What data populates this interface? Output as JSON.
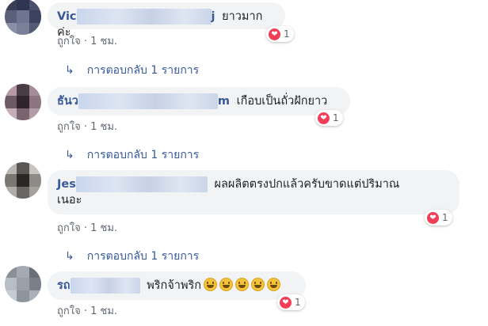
{
  "comments": [
    {
      "name_visible": "Vic",
      "name_suffix": "j",
      "text": "ยาวมากค่ะ",
      "reaction_count": "1",
      "like_label": "ถูกใจ",
      "time": "1 ชม.",
      "replies_label": "การตอบกลับ 1 รายการ"
    },
    {
      "name_visible": "ธันว",
      "name_suffix": "m",
      "text": "เกือบเป็นถั่วฝักยาว",
      "reaction_count": "1",
      "like_label": "ถูกใจ",
      "time": "1 ชม.",
      "replies_label": "การตอบกลับ 1 รายการ"
    },
    {
      "name_visible": "Jes",
      "text_line1": "ผลผลิตตรงปกแล้วครับขาดแต่ปริมาณ",
      "text_line2": "เนอะ",
      "reaction_count": "1",
      "like_label": "ถูกใจ",
      "time": "1 ชม.",
      "replies_label": "การตอบกลับ 1 รายการ"
    },
    {
      "name_visible": "รถ",
      "text": "พริกจ้าพริก",
      "reaction_count": "1",
      "like_label": "ถูกใจ",
      "time": "1 ชม."
    }
  ],
  "separator": "·",
  "icons": {
    "reaction": "love-reaction-icon",
    "reply_arrow": "reply-arrow-icon",
    "emoji": "grinning-face-emoji"
  },
  "colors": {
    "name": "#385898",
    "bubble": "#f2f3f5",
    "love": "#f33e58",
    "meta": "#606770"
  }
}
